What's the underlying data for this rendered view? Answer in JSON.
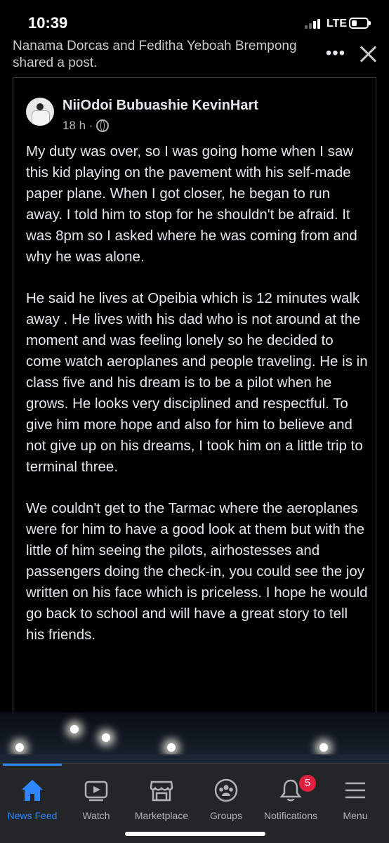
{
  "status_bar": {
    "time": "10:39",
    "network": "LTE"
  },
  "shared_by": "Nanama Dorcas and Feditha Yeboah Brempong shared a post.",
  "header_actions": {
    "more_label": "•••"
  },
  "post": {
    "author": "NiiOdoi Bubuashie KevinHart",
    "time": "18 h ·",
    "paragraphs": [
      "My duty was over, so I was going home when I saw this kid playing on the pavement with his self-made paper plane. When I got closer, he began to run away. I told him to stop for he shouldn't be afraid. It was 8pm so I asked where he was  coming from and why he was alone.",
      "He said he lives at Opeibia which is 12 minutes walk away . He lives with his dad who is not around at the moment and was feeling lonely so he decided to come watch aeroplanes and people traveling. He is in class five and his dream is to be a pilot when he grows. He looks very disciplined and respectful. To give him more hope and also for him to believe and not give up on his dreams, I took him on a little trip to terminal three.",
      "We couldn't get to the Tarmac  where the aeroplanes were for him to have a good look at them but with the little of  him seeing the pilots, airhostesses and passengers doing the  check-in, you could see the joy written on his face which is priceless. I hope he would go back to school and will have a great story to tell his friends."
    ]
  },
  "nav": {
    "items": [
      {
        "label": "News Feed",
        "icon": "home-icon",
        "active": true
      },
      {
        "label": "Watch",
        "icon": "watch-icon"
      },
      {
        "label": "Marketplace",
        "icon": "marketplace-icon"
      },
      {
        "label": "Groups",
        "icon": "groups-icon"
      },
      {
        "label": "Notifications",
        "icon": "bell-icon",
        "badge": "5"
      },
      {
        "label": "Menu",
        "icon": "menu-icon"
      }
    ]
  },
  "colors": {
    "accent": "#2d88ff",
    "badge": "#e41e3f",
    "background": "#000000",
    "nav_background": "#242526"
  }
}
